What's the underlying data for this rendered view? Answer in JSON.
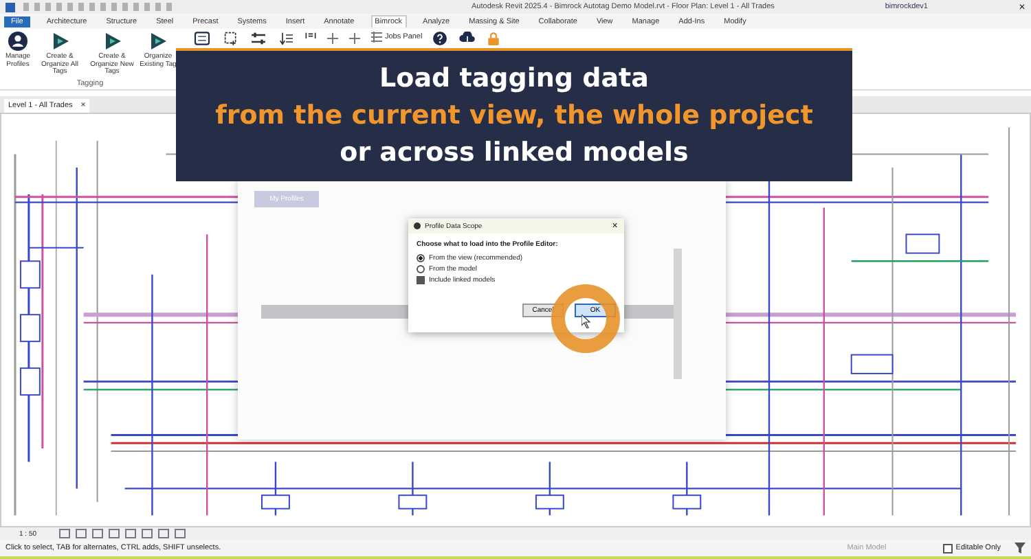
{
  "window": {
    "title": "Autodesk Revit 2025.4 - Bimrock Autotag Demo Model.rvt - Floor Plan: Level 1 - All Trades",
    "user": "bimrockdev1",
    "close": "✕"
  },
  "ribbon_tabs": [
    {
      "label": "File",
      "kind": "file",
      "selected": false
    },
    {
      "label": "Architecture",
      "kind": "tab",
      "selected": false
    },
    {
      "label": "Structure",
      "kind": "tab",
      "selected": false
    },
    {
      "label": "Steel",
      "kind": "tab",
      "selected": false
    },
    {
      "label": "Precast",
      "kind": "tab",
      "selected": false
    },
    {
      "label": "Systems",
      "kind": "tab",
      "selected": false
    },
    {
      "label": "Insert",
      "kind": "tab",
      "selected": false
    },
    {
      "label": "Annotate",
      "kind": "tab",
      "selected": false
    },
    {
      "label": "Bimrock",
      "kind": "tab",
      "selected": true
    },
    {
      "label": "Analyze",
      "kind": "tab",
      "selected": false
    },
    {
      "label": "Massing & Site",
      "kind": "tab",
      "selected": false
    },
    {
      "label": "Collaborate",
      "kind": "tab",
      "selected": false
    },
    {
      "label": "View",
      "kind": "tab",
      "selected": false
    },
    {
      "label": "Manage",
      "kind": "tab",
      "selected": false
    },
    {
      "label": "Add-Ins",
      "kind": "tab",
      "selected": false
    },
    {
      "label": "Modify",
      "kind": "tab",
      "selected": false
    }
  ],
  "ribbon_buttons": [
    {
      "label": "Manage Profiles",
      "kind": "profile"
    },
    {
      "label": "Create & Organize All Tags",
      "kind": "play"
    },
    {
      "label": "Create & Organize New Tags",
      "kind": "play"
    },
    {
      "label": "Organize Existing Tag",
      "kind": "play"
    }
  ],
  "ribbon_panel": {
    "label": "Tagging"
  },
  "jobs_button": {
    "label": "Jobs Panel"
  },
  "view_tab": {
    "label": "Level 1 - All Trades",
    "close": "×"
  },
  "banner": {
    "lines": [
      {
        "text": "Load tagging data",
        "highlight": false
      },
      {
        "text": "from the current view, the whole project",
        "highlight": true
      },
      {
        "text": "or across linked models",
        "highlight": false
      }
    ]
  },
  "background_dialog": {
    "tab": "My Profiles"
  },
  "dialog": {
    "title": "Profile Data Scope",
    "close": "✕",
    "prompt": "Choose what to load into the Profile Editor:",
    "options": [
      {
        "kind": "radio",
        "label": "From the view (recommended)",
        "checked": true
      },
      {
        "kind": "radio",
        "label": "From the model",
        "checked": false
      },
      {
        "kind": "checkbox",
        "label": "Include linked models",
        "checked": true
      }
    ],
    "buttons": [
      {
        "label": "Cancel",
        "default": false
      },
      {
        "label": "OK",
        "default": true
      }
    ]
  },
  "view_controls": {
    "scale": "1 : 50"
  },
  "status_bar": {
    "hint": "Click to select, TAB for alternates, CTRL adds, SHIFT unselects.",
    "editable_only": {
      "label": "Editable Only",
      "checked": false
    },
    "model": "Main Model"
  }
}
